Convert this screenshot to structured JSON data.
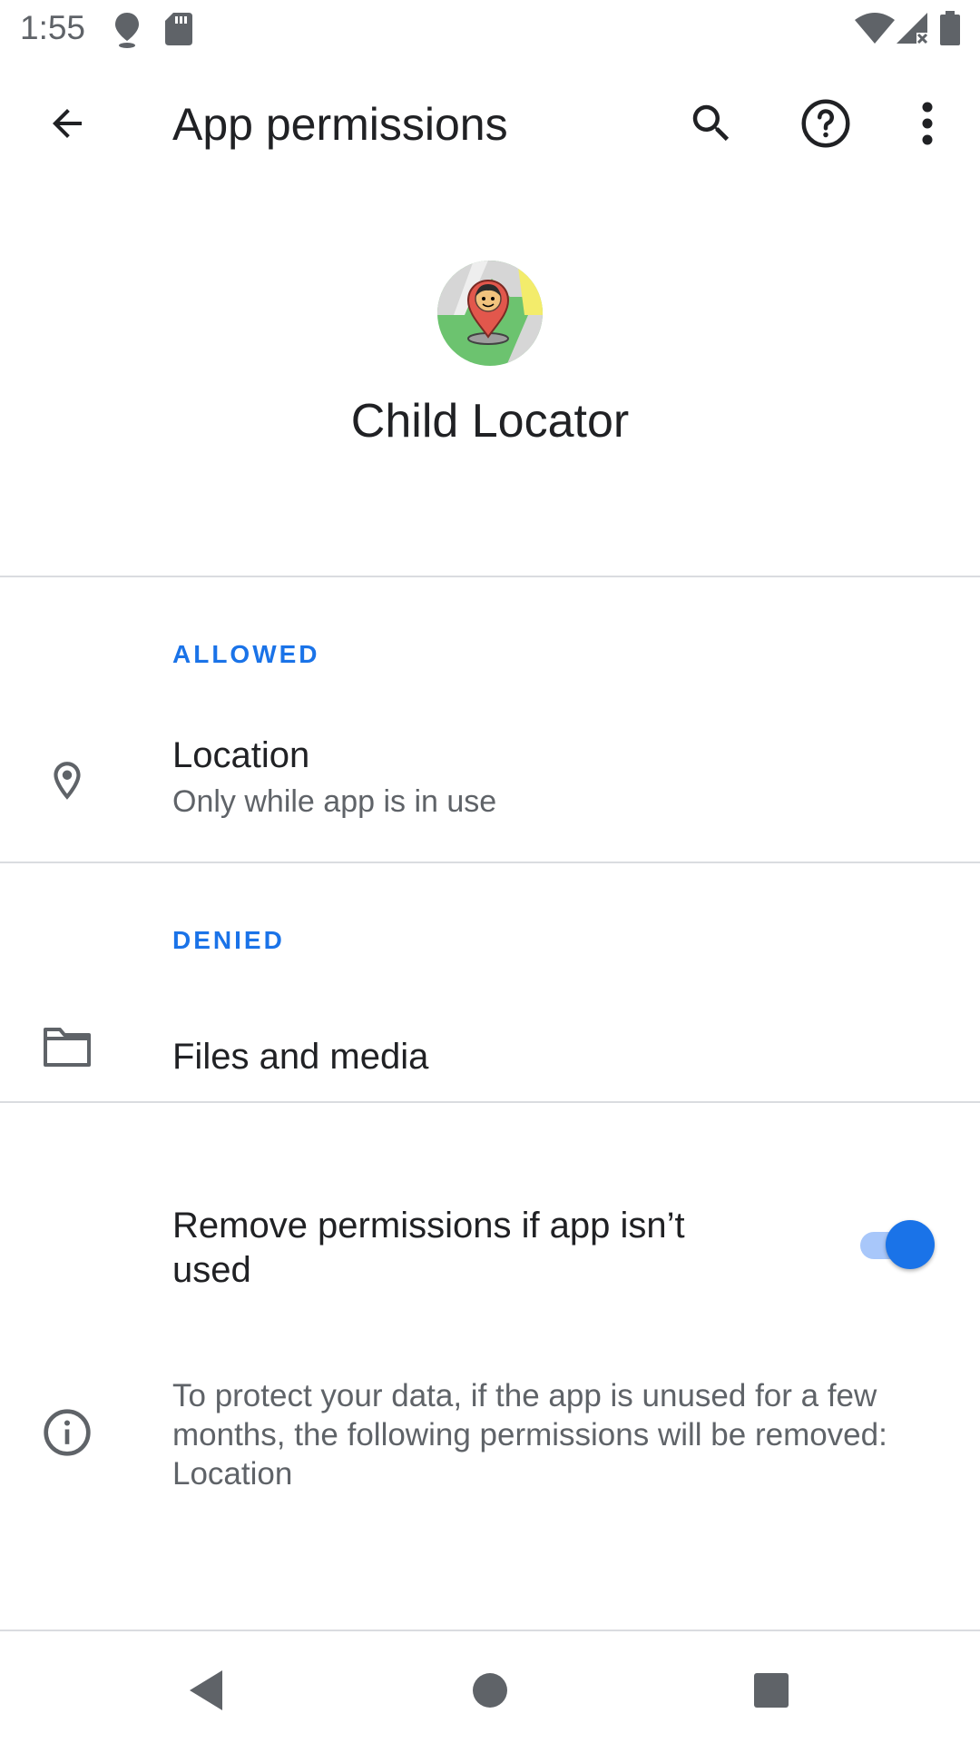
{
  "status_bar": {
    "time": "1:55",
    "icons": [
      "location-pin-icon",
      "sd-card-icon",
      "wifi-icon",
      "cellular-no-signal-icon",
      "battery-icon"
    ]
  },
  "app_bar": {
    "title": "App permissions",
    "icons": [
      "back-arrow-icon",
      "search-icon",
      "help-icon",
      "more-vert-icon"
    ]
  },
  "app": {
    "name": "Child Locator",
    "icon": "child-locator-app-icon"
  },
  "sections": {
    "allowed": {
      "header": "ALLOWED",
      "items": [
        {
          "title": "Location",
          "subtitle": "Only while app is in use",
          "icon": "location-icon"
        }
      ]
    },
    "denied": {
      "header": "DENIED",
      "items": [
        {
          "title": "Files and media",
          "icon": "folder-icon"
        }
      ]
    }
  },
  "auto_revoke": {
    "label": "Remove permissions if app isn’t used",
    "enabled": true,
    "info_icon": "info-icon",
    "info_text": "To protect your data, if the app is unused for a few months, the following permissions will be removed: Location"
  },
  "nav_bar": {
    "icons": [
      "nav-back-icon",
      "nav-home-icon",
      "nav-recents-icon"
    ]
  },
  "colors": {
    "accent": "#1a73e8",
    "text_primary": "#202124",
    "text_secondary": "#5f6368",
    "divider": "#dadce0"
  }
}
